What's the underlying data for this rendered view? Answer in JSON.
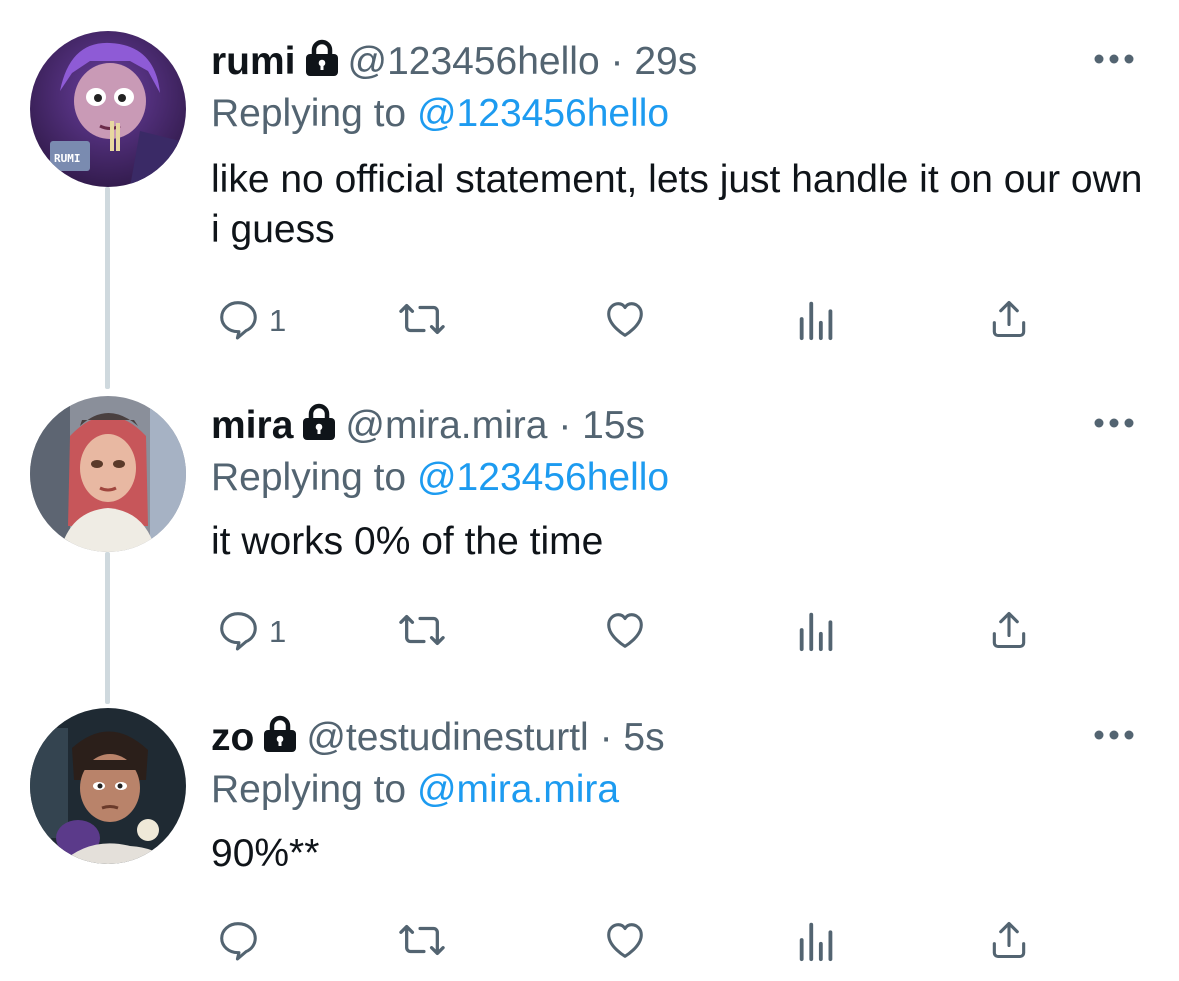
{
  "tweets": [
    {
      "name": "rumi",
      "handle": "@123456hello",
      "sep": "·",
      "time": "29s",
      "replying_prefix": "Replying to",
      "replying_to": "@123456hello",
      "text": "like no official statement, lets just handle it on our own i guess",
      "reply_count": "1",
      "avatar_label": "RUMI"
    },
    {
      "name": "mira",
      "handle": "@mira.mira",
      "sep": "·",
      "time": "15s",
      "replying_prefix": "Replying to",
      "replying_to": "@123456hello",
      "text": "it works 0% of the time",
      "reply_count": "1"
    },
    {
      "name": "zo",
      "handle": "@testudinesturtl",
      "sep": "·",
      "time": "5s",
      "replying_prefix": "Replying to",
      "replying_to": "@mira.mira",
      "text": "90%**",
      "reply_count": ""
    }
  ],
  "icons": {
    "lock": "lock-icon",
    "more": "more-icon",
    "reply": "reply-icon",
    "retweet": "retweet-icon",
    "like": "like-icon",
    "views": "views-icon",
    "share": "share-icon"
  },
  "colors": {
    "text": "#0f1419",
    "secondary": "#536471",
    "accent": "#1d9bf0",
    "thread_line": "#cfd9de"
  }
}
